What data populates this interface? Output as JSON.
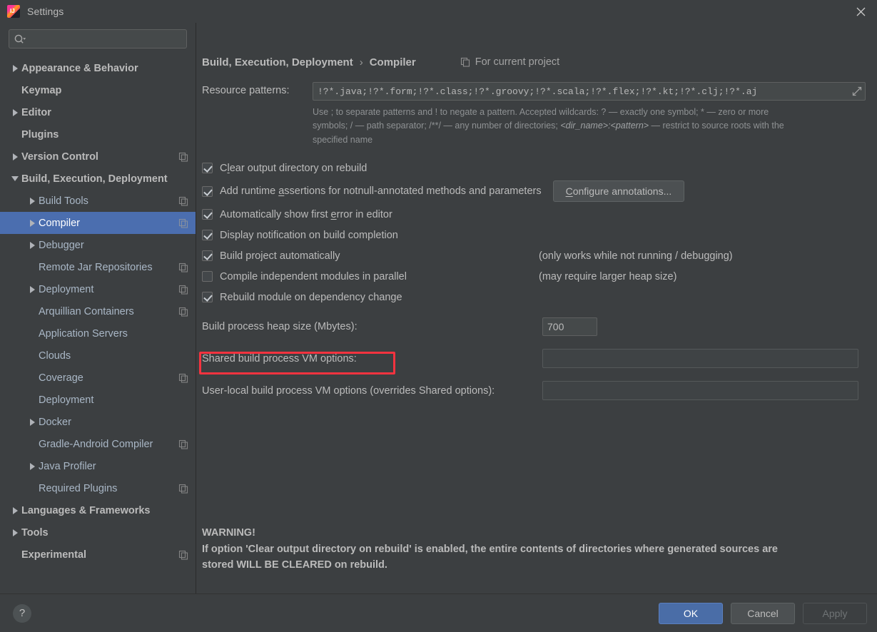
{
  "window": {
    "title": "Settings",
    "logo_icon": "intellij-idea-logo",
    "close_icon": "close-icon"
  },
  "sidebar": {
    "search": {
      "placeholder": "",
      "value": "",
      "icon": "search-icon"
    },
    "items": [
      {
        "label": "Appearance & Behavior",
        "arrow": "right",
        "indent": 0,
        "bold": true,
        "copy": false,
        "selected": false
      },
      {
        "label": "Keymap",
        "arrow": "none",
        "indent": 0,
        "bold": true,
        "copy": false,
        "selected": false
      },
      {
        "label": "Editor",
        "arrow": "right",
        "indent": 0,
        "bold": true,
        "copy": false,
        "selected": false
      },
      {
        "label": "Plugins",
        "arrow": "none",
        "indent": 0,
        "bold": true,
        "copy": false,
        "selected": false
      },
      {
        "label": "Version Control",
        "arrow": "right",
        "indent": 0,
        "bold": true,
        "copy": true,
        "selected": false
      },
      {
        "label": "Build, Execution, Deployment",
        "arrow": "down",
        "indent": 0,
        "bold": true,
        "copy": false,
        "selected": false
      },
      {
        "label": "Build Tools",
        "arrow": "right",
        "indent": 1,
        "bold": false,
        "copy": true,
        "selected": false
      },
      {
        "label": "Compiler",
        "arrow": "right",
        "indent": 1,
        "bold": false,
        "copy": true,
        "selected": true
      },
      {
        "label": "Debugger",
        "arrow": "right",
        "indent": 1,
        "bold": false,
        "copy": false,
        "selected": false
      },
      {
        "label": "Remote Jar Repositories",
        "arrow": "none",
        "indent": 1,
        "bold": false,
        "copy": true,
        "selected": false
      },
      {
        "label": "Deployment",
        "arrow": "right",
        "indent": 1,
        "bold": false,
        "copy": true,
        "selected": false
      },
      {
        "label": "Arquillian Containers",
        "arrow": "none",
        "indent": 1,
        "bold": false,
        "copy": true,
        "selected": false
      },
      {
        "label": "Application Servers",
        "arrow": "none",
        "indent": 1,
        "bold": false,
        "copy": false,
        "selected": false
      },
      {
        "label": "Clouds",
        "arrow": "none",
        "indent": 1,
        "bold": false,
        "copy": false,
        "selected": false
      },
      {
        "label": "Coverage",
        "arrow": "none",
        "indent": 1,
        "bold": false,
        "copy": true,
        "selected": false
      },
      {
        "label": "Deployment",
        "arrow": "none",
        "indent": 1,
        "bold": false,
        "copy": false,
        "selected": false
      },
      {
        "label": "Docker",
        "arrow": "right",
        "indent": 1,
        "bold": false,
        "copy": false,
        "selected": false
      },
      {
        "label": "Gradle-Android Compiler",
        "arrow": "none",
        "indent": 1,
        "bold": false,
        "copy": true,
        "selected": false
      },
      {
        "label": "Java Profiler",
        "arrow": "right",
        "indent": 1,
        "bold": false,
        "copy": false,
        "selected": false
      },
      {
        "label": "Required Plugins",
        "arrow": "none",
        "indent": 1,
        "bold": false,
        "copy": true,
        "selected": false
      },
      {
        "label": "Languages & Frameworks",
        "arrow": "right",
        "indent": 0,
        "bold": true,
        "copy": false,
        "selected": false
      },
      {
        "label": "Tools",
        "arrow": "right",
        "indent": 0,
        "bold": true,
        "copy": false,
        "selected": false
      },
      {
        "label": "Experimental",
        "arrow": "none",
        "indent": 0,
        "bold": true,
        "copy": true,
        "selected": false
      }
    ]
  },
  "content": {
    "breadcrumb": {
      "root": "Build, Execution, Deployment",
      "separator": "›",
      "leaf": "Compiler"
    },
    "for_current_project": {
      "label": "For current project",
      "icon": "copy-icon"
    },
    "resource_patterns": {
      "label": "Resource patterns:",
      "value": "!?*.java;!?*.form;!?*.class;!?*.groovy;!?*.scala;!?*.flex;!?*.kt;!?*.clj;!?*.aj",
      "expand_icon": "expand-icon"
    },
    "hint_line1": "Use ; to separate patterns and ! to negate a pattern. Accepted wildcards: ? — exactly one symbol; * — zero or more",
    "hint_line2_a": "symbols; / — path separator; /**/ — any number of directories; ",
    "hint_line2_b": "<dir_name>:<pattern>",
    "hint_line2_c": " — restrict to source roots with the",
    "hint_line3": "specified name",
    "checkboxes": [
      {
        "label_pre": "C",
        "label_mn": "l",
        "label_post": "ear output directory on rebuild",
        "checked": true,
        "note": ""
      },
      {
        "label_pre": "Add runtime ",
        "label_mn": "a",
        "label_post": "ssertions for notnull-annotated methods and parameters",
        "checked": true,
        "note": ""
      },
      {
        "label_pre": "Automatically show first ",
        "label_mn": "e",
        "label_post": "rror in editor",
        "checked": true,
        "note": ""
      },
      {
        "label_pre": "Display notification on build completion",
        "label_mn": "",
        "label_post": "",
        "checked": true,
        "note": ""
      },
      {
        "label_pre": "Build project automatically",
        "label_mn": "",
        "label_post": "",
        "checked": true,
        "note": "(only works while not running / debugging)"
      },
      {
        "label_pre": "Compile independent modules in parallel",
        "label_mn": "",
        "label_post": "",
        "checked": false,
        "note": "(may require larger heap size)"
      },
      {
        "label_pre": "Rebuild module on dependency change",
        "label_mn": "",
        "label_post": "",
        "checked": true,
        "note": ""
      }
    ],
    "configure_annotations": {
      "pre": "",
      "mn": "C",
      "post": "onfigure annotations..."
    },
    "heap": {
      "label": "Build process heap size (Mbytes):",
      "value": "700"
    },
    "shared_vm": {
      "label": "Shared build process VM options:",
      "value": ""
    },
    "userlocal_vm": {
      "label": "User-local build process VM options (overrides Shared options):",
      "value": ""
    },
    "warning": {
      "title": "WARNING!",
      "line1": "If option 'Clear output directory on rebuild' is enabled, the entire contents of directories where generated sources are",
      "line2": "stored WILL BE CLEARED on rebuild."
    },
    "annotation_color": "#f5333f"
  },
  "footer": {
    "help_label": "?",
    "ok": "OK",
    "cancel": "Cancel",
    "apply": "Apply"
  },
  "colors": {
    "background": "#3c3f41",
    "selection": "#4b6eaf",
    "primary_button": "#4a6da7",
    "text": "#bbbbbb",
    "annotation": "#f5333f"
  }
}
